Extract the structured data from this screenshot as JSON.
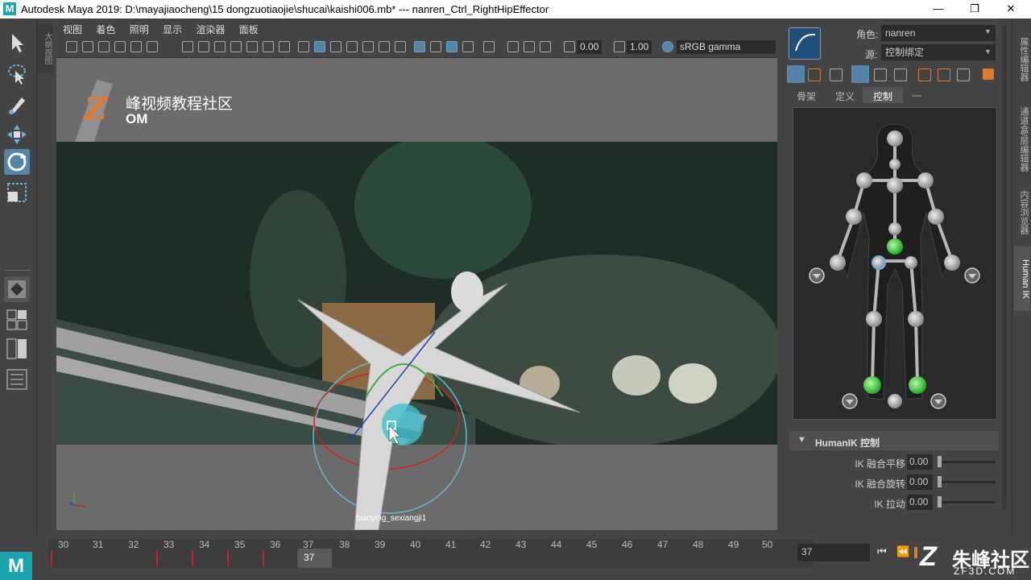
{
  "window": {
    "title": "Autodesk Maya 2019: D:\\mayajiaocheng\\15 dongzuotiaojie\\shucai\\kaishi006.mb*   ---   nanren_Ctrl_RightHipEffector",
    "app_logo": "M",
    "minimize": "—",
    "restore": "❐",
    "close": "✕"
  },
  "left_tools": {
    "outliner_tab": "大纲视图"
  },
  "viewport": {
    "menus": [
      "视图",
      "着色",
      "照明",
      "显示",
      "渲染器",
      "面板"
    ],
    "near_value": "0.00",
    "far_value": "1.00",
    "color_space": "sRGB gamma",
    "watermark_text": "峰视频教程社区",
    "watermark_sub": "OM",
    "camera_label": "bianying_sexiangji1"
  },
  "hik": {
    "character_label": "角色:",
    "character_value": "nanren",
    "source_label": "源:",
    "source_value": "控制绑定",
    "tabs": [
      "骨架",
      "定义",
      "控制",
      "---"
    ],
    "active_tab": "控制",
    "section_title": "HumanIK 控制",
    "params": [
      {
        "label": "IK 融合平移",
        "value": "0.00"
      },
      {
        "label": "IK 融合旋转",
        "value": "0.00"
      },
      {
        "label": "IK 拉动",
        "value": "0.00"
      }
    ]
  },
  "side_tabs": [
    "属性编辑器",
    "通道盒/层编辑器",
    "内容浏览器",
    "Human IK"
  ],
  "timeline": {
    "frames": [
      "30",
      "31",
      "32",
      "33",
      "34",
      "35",
      "36",
      "37",
      "38",
      "39",
      "40",
      "41",
      "42",
      "43",
      "44",
      "45",
      "46",
      "47",
      "48",
      "49",
      "50"
    ],
    "current_frame": "37",
    "current_frame_field": "37"
  },
  "branding": {
    "site_name": "朱峰社区",
    "site_url": "ZF3D.COM"
  },
  "colors": {
    "accent": "#5285a6",
    "hik_green": "#2ecc40",
    "hik_grey": "#9a9a9a"
  }
}
